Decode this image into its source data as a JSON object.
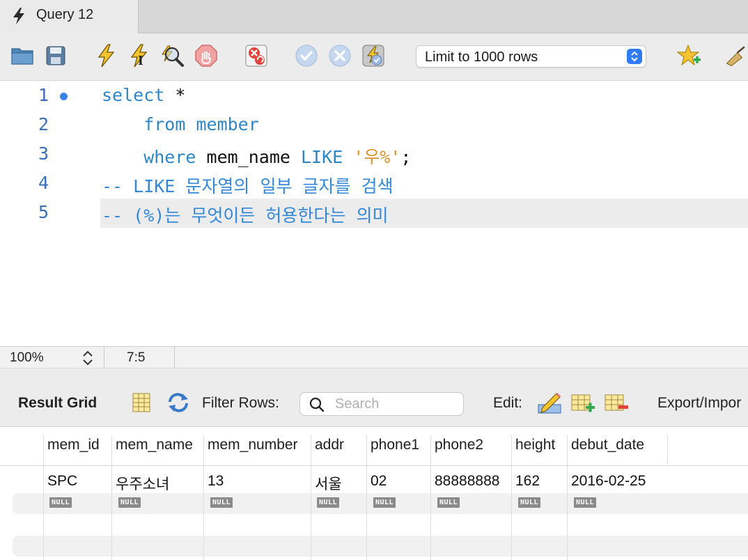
{
  "tab": {
    "title": "Query 12"
  },
  "toolbar": {
    "limit_selected": "Limit to 1000 rows",
    "buttons": [
      "open-folder-icon",
      "save-icon",
      "execute-icon",
      "execute-current-icon",
      "explain-icon",
      "stop-icon",
      "toggle-error-icon",
      "commit-icon",
      "rollback-icon",
      "autocommit-icon",
      "bookmark-star-icon",
      "beautify-brush-icon"
    ]
  },
  "editor": {
    "lines": [
      {
        "no": "1",
        "tokens": [
          {
            "t": "select",
            "c": "kw"
          },
          {
            "t": " *",
            "c": "plain"
          }
        ]
      },
      {
        "no": "2",
        "tokens": [
          {
            "t": "    from member",
            "c": "kw"
          }
        ]
      },
      {
        "no": "3",
        "tokens": [
          {
            "t": "    where",
            "c": "kw"
          },
          {
            "t": " mem_name ",
            "c": "plain"
          },
          {
            "t": "LIKE",
            "c": "kw"
          },
          {
            "t": " ",
            "c": "plain"
          },
          {
            "t": "'우%'",
            "c": "str"
          },
          {
            "t": ";",
            "c": "plain"
          }
        ]
      },
      {
        "no": "4",
        "tokens": [
          {
            "t": "-- LIKE 문자열의 일부 글자를 검색",
            "c": "cmt"
          }
        ]
      },
      {
        "no": "5",
        "tokens": [
          {
            "t": "-- (%)는 무엇이든 허용한다는 의미",
            "c": "cmt"
          }
        ]
      }
    ]
  },
  "status": {
    "zoom": "100%",
    "cursor": "7:5"
  },
  "result": {
    "title": "Result Grid",
    "filter_label": "Filter Rows:",
    "search_placeholder": "Search",
    "edit_label": "Edit:",
    "export_label": "Export/Impor",
    "columns": [
      "mem_id",
      "mem_name",
      "mem_number",
      "addr",
      "phone1",
      "phone2",
      "height",
      "debut_date"
    ],
    "rows": [
      [
        "SPC",
        "우주소녀",
        "13",
        "서울",
        "02",
        "88888888",
        "162",
        "2016-02-25"
      ]
    ],
    "null_label": "NULL"
  }
}
